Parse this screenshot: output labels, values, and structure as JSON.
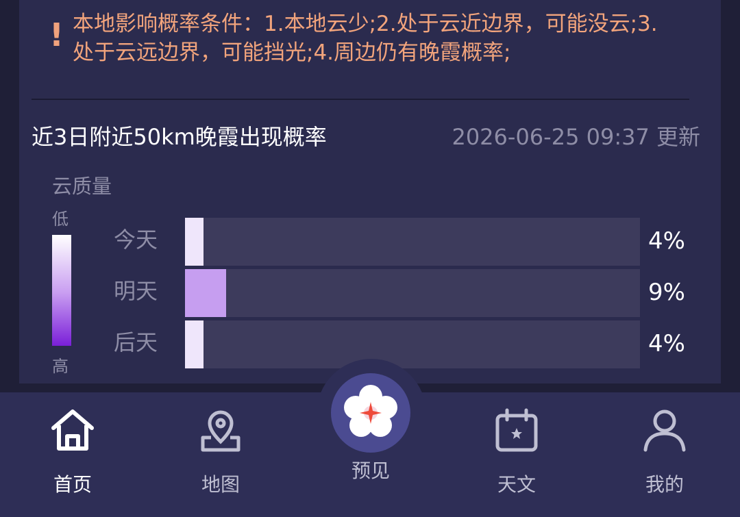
{
  "notice": {
    "bang": "!",
    "text": "本地影响概率条件：1.本地云少;2.处于云近边界，可能没云;3.处于云远边界，可能挡光;4.周边仍有晚霞概率;"
  },
  "forecast": {
    "title": "近3日附近50km晚霞出现概率",
    "updated": "2026-06-25 09:37 更新",
    "legend": {
      "title": "云质量",
      "low": "低",
      "high": "高"
    },
    "rows": [
      {
        "day": "今天",
        "percent_label": "4%",
        "value": 0.04,
        "color": "#efe6fb"
      },
      {
        "day": "明天",
        "percent_label": "9%",
        "value": 0.09,
        "color": "#c69ef0"
      },
      {
        "day": "后天",
        "percent_label": "4%",
        "value": 0.04,
        "color": "#efe6fb"
      }
    ]
  },
  "nav": {
    "items": [
      {
        "label": "首页",
        "icon": "home-icon",
        "active": true
      },
      {
        "label": "地图",
        "icon": "map-pin-icon",
        "active": false
      },
      {
        "label": "预见",
        "icon": "plum-blossom-icon",
        "active": false
      },
      {
        "label": "天文",
        "icon": "calendar-icon",
        "active": false
      },
      {
        "label": "我的",
        "icon": "user-icon",
        "active": false
      }
    ]
  },
  "colors": {
    "background": "#1f1f37",
    "card": "#2b2b4e",
    "accent": "#f2a47c",
    "track": "#3d3b5c",
    "nav": "#2e2e56"
  }
}
